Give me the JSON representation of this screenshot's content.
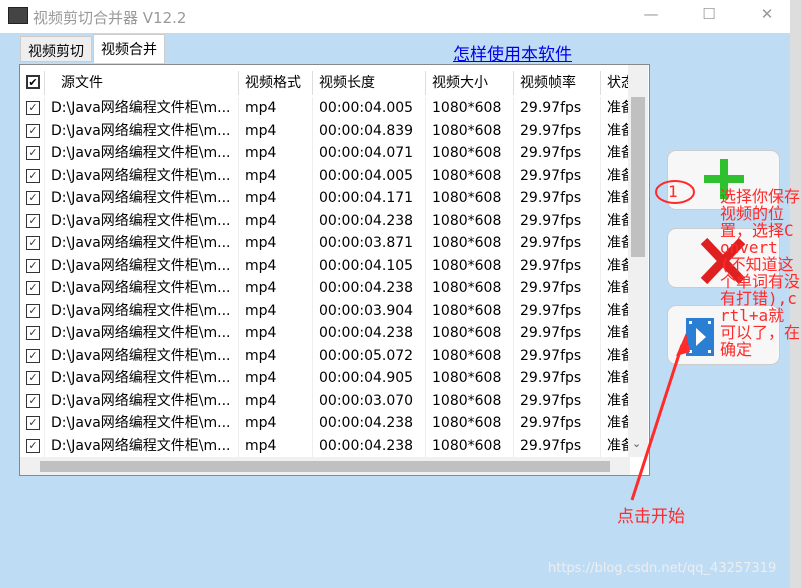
{
  "window": {
    "title": "视频剪切合并器 V12.2",
    "minimize": "—",
    "maximize": "☐",
    "close": "✕"
  },
  "tabs": [
    {
      "label": "视频剪切"
    },
    {
      "label": "视频合并"
    }
  ],
  "help_link": "怎样使用本软件",
  "table": {
    "headers": [
      "源文件",
      "视频格式",
      "视频长度",
      "视频大小",
      "视频帧率",
      "状态"
    ],
    "rows": [
      {
        "file": "D:\\Java网络编程文件柜\\m...",
        "format": "mp4",
        "duration": "00:00:04.005",
        "size": "1080*608",
        "fps": "29.97fps",
        "status": "准备"
      },
      {
        "file": "D:\\Java网络编程文件柜\\m...",
        "format": "mp4",
        "duration": "00:00:04.839",
        "size": "1080*608",
        "fps": "29.97fps",
        "status": "准备"
      },
      {
        "file": "D:\\Java网络编程文件柜\\m...",
        "format": "mp4",
        "duration": "00:00:04.071",
        "size": "1080*608",
        "fps": "29.97fps",
        "status": "准备"
      },
      {
        "file": "D:\\Java网络编程文件柜\\m...",
        "format": "mp4",
        "duration": "00:00:04.005",
        "size": "1080*608",
        "fps": "29.97fps",
        "status": "准备"
      },
      {
        "file": "D:\\Java网络编程文件柜\\m...",
        "format": "mp4",
        "duration": "00:00:04.171",
        "size": "1080*608",
        "fps": "29.97fps",
        "status": "准备"
      },
      {
        "file": "D:\\Java网络编程文件柜\\m...",
        "format": "mp4",
        "duration": "00:00:04.238",
        "size": "1080*608",
        "fps": "29.97fps",
        "status": "准备"
      },
      {
        "file": "D:\\Java网络编程文件柜\\m...",
        "format": "mp4",
        "duration": "00:00:03.871",
        "size": "1080*608",
        "fps": "29.97fps",
        "status": "准备"
      },
      {
        "file": "D:\\Java网络编程文件柜\\m...",
        "format": "mp4",
        "duration": "00:00:04.105",
        "size": "1080*608",
        "fps": "29.97fps",
        "status": "准备"
      },
      {
        "file": "D:\\Java网络编程文件柜\\m...",
        "format": "mp4",
        "duration": "00:00:04.238",
        "size": "1080*608",
        "fps": "29.97fps",
        "status": "准备"
      },
      {
        "file": "D:\\Java网络编程文件柜\\m...",
        "format": "mp4",
        "duration": "00:00:03.904",
        "size": "1080*608",
        "fps": "29.97fps",
        "status": "准备"
      },
      {
        "file": "D:\\Java网络编程文件柜\\m...",
        "format": "mp4",
        "duration": "00:00:04.238",
        "size": "1080*608",
        "fps": "29.97fps",
        "status": "准备"
      },
      {
        "file": "D:\\Java网络编程文件柜\\m...",
        "format": "mp4",
        "duration": "00:00:05.072",
        "size": "1080*608",
        "fps": "29.97fps",
        "status": "准备"
      },
      {
        "file": "D:\\Java网络编程文件柜\\m...",
        "format": "mp4",
        "duration": "00:00:04.905",
        "size": "1080*608",
        "fps": "29.97fps",
        "status": "准备"
      },
      {
        "file": "D:\\Java网络编程文件柜\\m...",
        "format": "mp4",
        "duration": "00:00:03.070",
        "size": "1080*608",
        "fps": "29.97fps",
        "status": "准备"
      },
      {
        "file": "D:\\Java网络编程文件柜\\m...",
        "format": "mp4",
        "duration": "00:00:04.238",
        "size": "1080*608",
        "fps": "29.97fps",
        "status": "准备"
      },
      {
        "file": "D:\\Java网络编程文件柜\\m...",
        "format": "mp4",
        "duration": "00:00:04.238",
        "size": "1080*608",
        "fps": "29.97fps",
        "status": "准备"
      }
    ]
  },
  "buttons": [
    {
      "icon": "plus-icon"
    },
    {
      "icon": "delete-x-icon"
    },
    {
      "icon": "play-video-icon"
    }
  ],
  "annotations": {
    "circle_label": "1",
    "note": "选择你保存视频的位置，选择Convert(不知道这个单词有没有打错),crtl+a就可以了，在确定",
    "click_start": "点击开始"
  },
  "watermark": "https://blog.csdn.net/qq_43257319",
  "colors": {
    "annotation": "#ff2a2a",
    "link": "#0000ee",
    "background": "#bfdcf5"
  }
}
